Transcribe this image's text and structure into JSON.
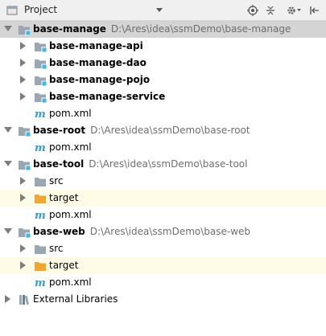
{
  "panel": {
    "title": "Project",
    "dropdown_icon": "chevron-down-icon",
    "toolbar": [
      "scroll-from-source-icon",
      "collapse-all-icon",
      "settings-icon",
      "hide-icon"
    ]
  },
  "colors": {
    "selected_row": "#d4d4d4",
    "highlighted_row": "#fefce6",
    "folder": "#9aa7b0",
    "excluded_folder": "#f0a732",
    "module_badge": "#40b6e0",
    "maven": "#3a9bd9"
  },
  "tree": [
    {
      "label": "base-manage",
      "path": "D:\\Ares\\idea\\ssmDemo\\base-manage",
      "expanded": true,
      "selected": true
    },
    {
      "label": "base-manage-api",
      "expanded": false
    },
    {
      "label": "base-manage-dao",
      "expanded": false
    },
    {
      "label": "base-manage-pojo",
      "expanded": false
    },
    {
      "label": "base-manage-service",
      "expanded": false
    },
    {
      "label": "pom.xml"
    },
    {
      "label": "base-root",
      "path": "D:\\Ares\\idea\\ssmDemo\\base-root",
      "expanded": true
    },
    {
      "label": "pom.xml"
    },
    {
      "label": "base-tool",
      "path": "D:\\Ares\\idea\\ssmDemo\\base-tool",
      "expanded": true
    },
    {
      "label": "src",
      "expanded": false
    },
    {
      "label": "target",
      "expanded": false,
      "highlighted": true
    },
    {
      "label": "pom.xml"
    },
    {
      "label": "base-web",
      "path": "D:\\Ares\\idea\\ssmDemo\\base-web",
      "expanded": true
    },
    {
      "label": "src",
      "expanded": false
    },
    {
      "label": "target",
      "expanded": false,
      "highlighted": true
    },
    {
      "label": "pom.xml"
    },
    {
      "label": "External Libraries",
      "expanded": false
    }
  ]
}
